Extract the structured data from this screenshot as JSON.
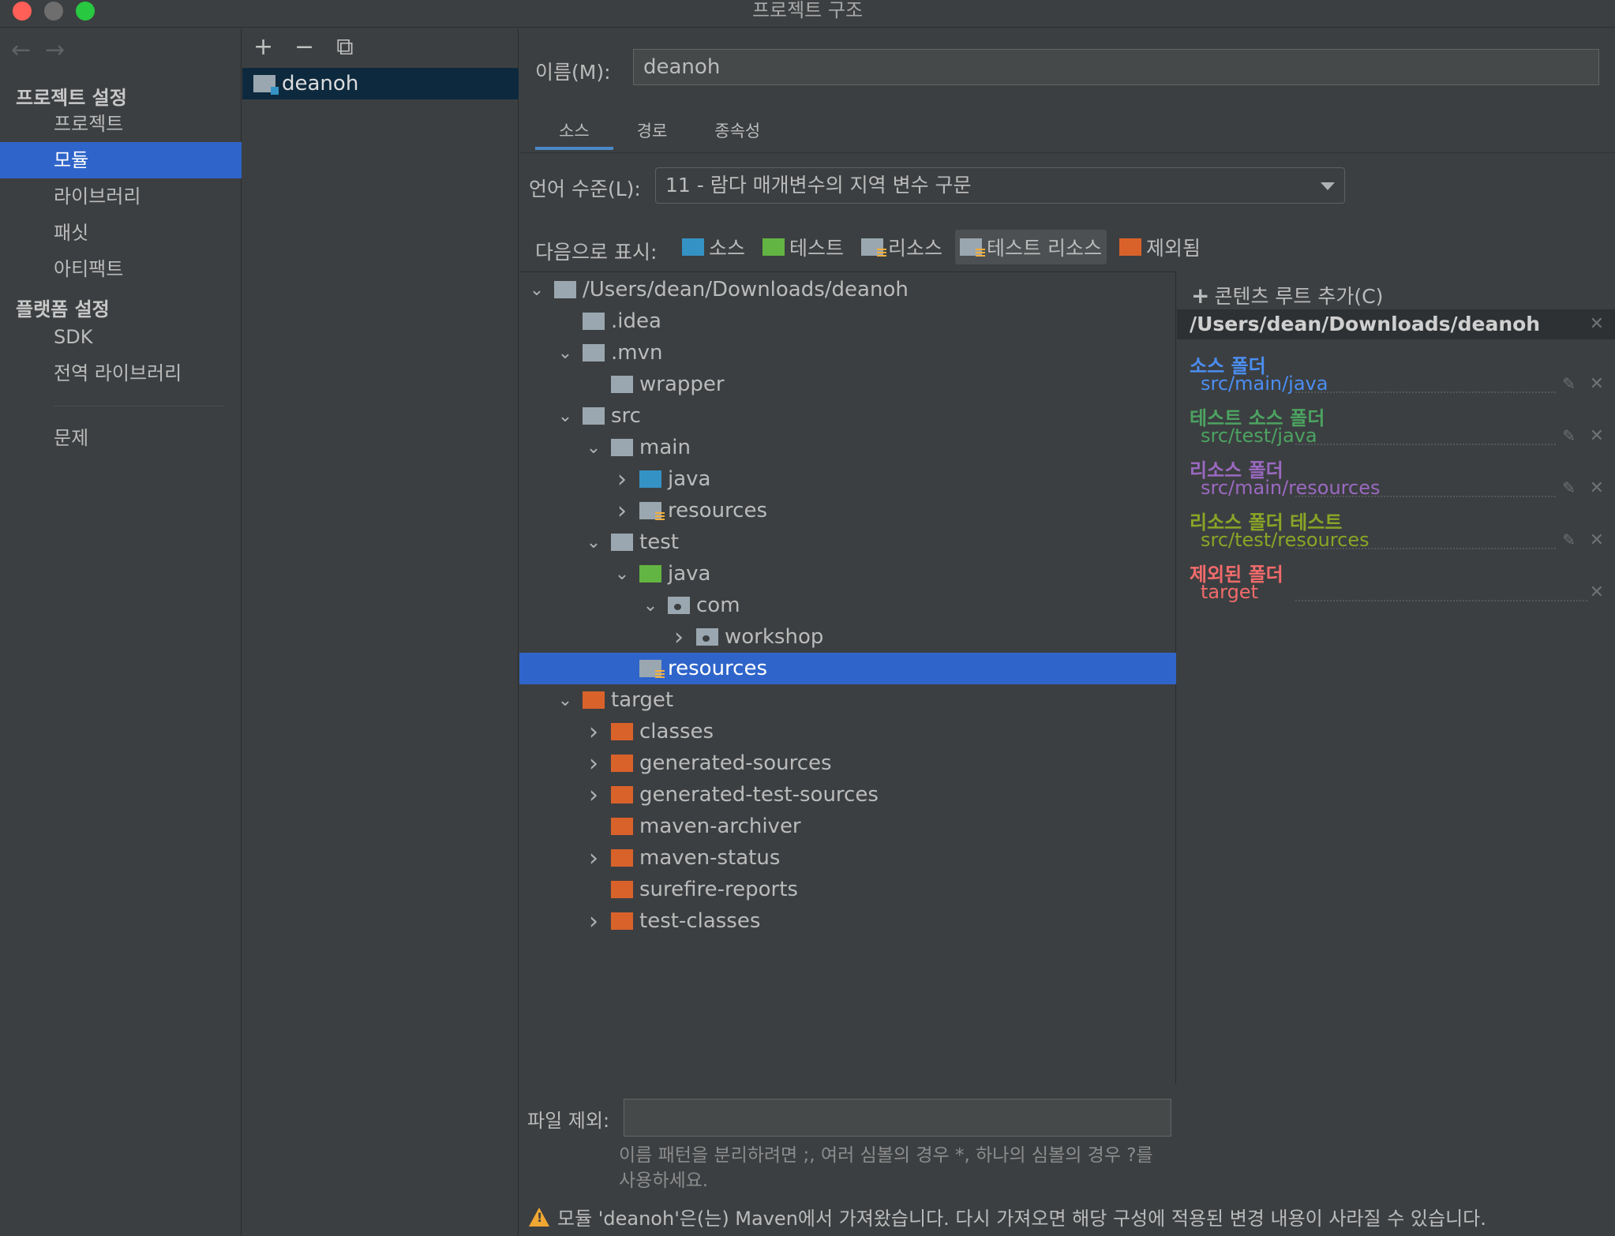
{
  "window": {
    "title": "프로젝트 구조"
  },
  "nav": {
    "project_settings": "프로젝트 설정",
    "platform_settings": "플랫폼 설정",
    "items": [
      "프로젝트",
      "모듈",
      "라이브러리",
      "패싯",
      "아티팩트"
    ],
    "platform_items": [
      "SDK",
      "전역 라이브러리"
    ],
    "problems": "문제",
    "selected": "모듈"
  },
  "modules": {
    "add": "+",
    "remove": "−",
    "copy": "⧉",
    "items": [
      "deanoh"
    ]
  },
  "name": {
    "label": "이름(M):",
    "value": "deanoh"
  },
  "tabs": [
    "소스",
    "경로",
    "종속성"
  ],
  "language_level": {
    "label": "언어 수준(L):",
    "value": "11 - 람다 매개변수의 지역 변수 구문"
  },
  "mark_as": {
    "label": "다음으로 표시:",
    "buttons": [
      "소스",
      "테스트",
      "리소스",
      "테스트 리소스",
      "제외됨"
    ]
  },
  "tree": [
    {
      "name": "/Users/dean/Downloads/deanoh",
      "expander": "down",
      "type": "gray"
    },
    {
      "name": ".idea",
      "expander": "",
      "type": "gray"
    },
    {
      "name": ".mvn",
      "expander": "down",
      "type": "gray"
    },
    {
      "name": "wrapper",
      "expander": "",
      "type": "gray"
    },
    {
      "name": "src",
      "expander": "down",
      "type": "gray"
    },
    {
      "name": "main",
      "expander": "down",
      "type": "gray"
    },
    {
      "name": "java",
      "expander": "right",
      "type": "blue"
    },
    {
      "name": "resources",
      "expander": "right",
      "type": "res"
    },
    {
      "name": "test",
      "expander": "down",
      "type": "gray"
    },
    {
      "name": "java",
      "expander": "down",
      "type": "green"
    },
    {
      "name": "com",
      "expander": "down",
      "type": "pkg"
    },
    {
      "name": "workshop",
      "expander": "right",
      "type": "pkg"
    },
    {
      "name": "resources",
      "expander": "",
      "type": "testres"
    },
    {
      "name": "target",
      "expander": "down",
      "type": "orange"
    },
    {
      "name": "classes",
      "expander": "right",
      "type": "orange"
    },
    {
      "name": "generated-sources",
      "expander": "right",
      "type": "orange"
    },
    {
      "name": "generated-test-sources",
      "expander": "right",
      "type": "orange"
    },
    {
      "name": "maven-archiver",
      "expander": "",
      "type": "orange"
    },
    {
      "name": "maven-status",
      "expander": "right",
      "type": "orange"
    },
    {
      "name": "surefire-reports",
      "expander": "",
      "type": "orange"
    },
    {
      "name": "test-classes",
      "expander": "right",
      "type": "orange"
    }
  ],
  "roots": {
    "add_label": "콘텐츠 루트 추가(C)",
    "root_path": "/Users/dean/Downloads/deanoh",
    "groups": [
      {
        "title": "소스 폴더",
        "path": "src/main/java",
        "color": "#4b8ef2"
      },
      {
        "title": "테스트 소스 폴더",
        "path": "src/test/java",
        "color": "#4ca361"
      },
      {
        "title": "리소스 폴더",
        "path": "src/main/resources",
        "color": "#9a69c1"
      },
      {
        "title": "리소스 폴더 테스트",
        "path": "src/test/resources",
        "color": "#8aa527"
      },
      {
        "title": "제외된 폴더",
        "path": "target",
        "color": "#f26b6b"
      }
    ]
  },
  "exclude": {
    "label": "파일 제외:",
    "value": "",
    "hint": "이름 패턴을 분리하려면 ;, 여러 심볼의 경우 *, 하나의 심볼의 경우 ?를 사용하세요."
  },
  "warning": "모듈 'deanoh'은(는) Maven에서 가져왔습니다. 다시 가져오면 해당 구성에 적용된 변경 내용이 사라질 수 있습니다."
}
